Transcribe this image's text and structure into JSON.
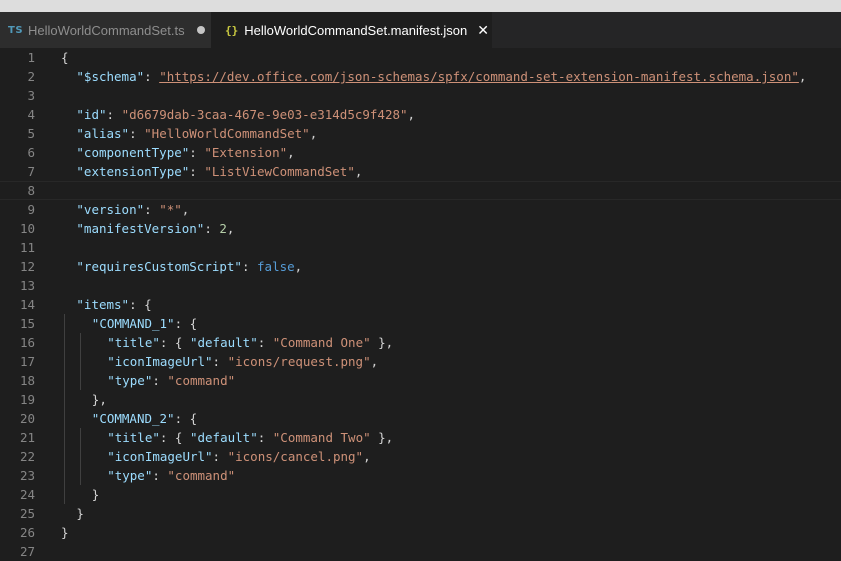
{
  "tabs": [
    {
      "icon_text": "TS",
      "icon": "typescript-file-icon",
      "label": "HelloWorldCommandSet.ts",
      "state": "modified"
    },
    {
      "icon_text": "{}",
      "icon": "json-file-icon",
      "label": "HelloWorldCommandSet.manifest.json",
      "state": "active"
    }
  ],
  "close_glyph": "✕",
  "colors": {
    "editor_bg": "#1e1e1e",
    "key": "#9cdcfe",
    "string": "#ce9178",
    "boolean": "#569cd6",
    "number": "#b5cea8",
    "line_number": "#858585"
  },
  "code_lines": [
    {
      "n": "1",
      "indent": 0,
      "tokens": [
        [
          "p",
          "{"
        ]
      ]
    },
    {
      "n": "2",
      "indent": 1,
      "tokens": [
        [
          "k",
          "\"$schema\""
        ],
        [
          "p",
          ": "
        ],
        [
          "u",
          "\"https://dev.office.com/json-schemas/spfx/command-set-extension-manifest.schema.json\""
        ],
        [
          "p",
          ","
        ]
      ]
    },
    {
      "n": "3",
      "indent": 1,
      "tokens": []
    },
    {
      "n": "4",
      "indent": 1,
      "tokens": [
        [
          "k",
          "\"id\""
        ],
        [
          "p",
          ": "
        ],
        [
          "s",
          "\"d6679dab-3caa-467e-9e03-e314d5c9f428\""
        ],
        [
          "p",
          ","
        ]
      ]
    },
    {
      "n": "5",
      "indent": 1,
      "tokens": [
        [
          "k",
          "\"alias\""
        ],
        [
          "p",
          ": "
        ],
        [
          "s",
          "\"HelloWorldCommandSet\""
        ],
        [
          "p",
          ","
        ]
      ]
    },
    {
      "n": "6",
      "indent": 1,
      "tokens": [
        [
          "k",
          "\"componentType\""
        ],
        [
          "p",
          ": "
        ],
        [
          "s",
          "\"Extension\""
        ],
        [
          "p",
          ","
        ]
      ]
    },
    {
      "n": "7",
      "indent": 1,
      "tokens": [
        [
          "k",
          "\"extensionType\""
        ],
        [
          "p",
          ": "
        ],
        [
          "s",
          "\"ListViewCommandSet\""
        ],
        [
          "p",
          ","
        ]
      ]
    },
    {
      "n": "8",
      "indent": 0,
      "tokens": [],
      "current": true
    },
    {
      "n": "9",
      "indent": 1,
      "tokens": [
        [
          "k",
          "\"version\""
        ],
        [
          "p",
          ": "
        ],
        [
          "s",
          "\"*\""
        ],
        [
          "p",
          ","
        ]
      ]
    },
    {
      "n": "10",
      "indent": 1,
      "tokens": [
        [
          "k",
          "\"manifestVersion\""
        ],
        [
          "p",
          ": "
        ],
        [
          "n",
          "2"
        ],
        [
          "p",
          ","
        ]
      ]
    },
    {
      "n": "11",
      "indent": 1,
      "tokens": []
    },
    {
      "n": "12",
      "indent": 1,
      "tokens": [
        [
          "k",
          "\"requiresCustomScript\""
        ],
        [
          "p",
          ": "
        ],
        [
          "b",
          "false"
        ],
        [
          "p",
          ","
        ]
      ]
    },
    {
      "n": "13",
      "indent": 1,
      "tokens": []
    },
    {
      "n": "14",
      "indent": 1,
      "tokens": [
        [
          "k",
          "\"items\""
        ],
        [
          "p",
          ": {"
        ]
      ]
    },
    {
      "n": "15",
      "indent": 2,
      "tokens": [
        [
          "k",
          "\"COMMAND_1\""
        ],
        [
          "p",
          ": {"
        ]
      ]
    },
    {
      "n": "16",
      "indent": 3,
      "tokens": [
        [
          "k",
          "\"title\""
        ],
        [
          "p",
          ": { "
        ],
        [
          "k",
          "\"default\""
        ],
        [
          "p",
          ": "
        ],
        [
          "s",
          "\"Command One\""
        ],
        [
          "p",
          " },"
        ]
      ]
    },
    {
      "n": "17",
      "indent": 3,
      "tokens": [
        [
          "k",
          "\"iconImageUrl\""
        ],
        [
          "p",
          ": "
        ],
        [
          "s",
          "\"icons/request.png\""
        ],
        [
          "p",
          ","
        ]
      ]
    },
    {
      "n": "18",
      "indent": 3,
      "tokens": [
        [
          "k",
          "\"type\""
        ],
        [
          "p",
          ": "
        ],
        [
          "s",
          "\"command\""
        ]
      ]
    },
    {
      "n": "19",
      "indent": 2,
      "tokens": [
        [
          "p",
          "},"
        ]
      ]
    },
    {
      "n": "20",
      "indent": 2,
      "tokens": [
        [
          "k",
          "\"COMMAND_2\""
        ],
        [
          "p",
          ": {"
        ]
      ]
    },
    {
      "n": "21",
      "indent": 3,
      "tokens": [
        [
          "k",
          "\"title\""
        ],
        [
          "p",
          ": { "
        ],
        [
          "k",
          "\"default\""
        ],
        [
          "p",
          ": "
        ],
        [
          "s",
          "\"Command Two\""
        ],
        [
          "p",
          " },"
        ]
      ]
    },
    {
      "n": "22",
      "indent": 3,
      "tokens": [
        [
          "k",
          "\"iconImageUrl\""
        ],
        [
          "p",
          ": "
        ],
        [
          "s",
          "\"icons/cancel.png\""
        ],
        [
          "p",
          ","
        ]
      ]
    },
    {
      "n": "23",
      "indent": 3,
      "tokens": [
        [
          "k",
          "\"type\""
        ],
        [
          "p",
          ": "
        ],
        [
          "s",
          "\"command\""
        ]
      ]
    },
    {
      "n": "24",
      "indent": 2,
      "tokens": [
        [
          "p",
          "}"
        ]
      ]
    },
    {
      "n": "25",
      "indent": 1,
      "tokens": [
        [
          "p",
          "}"
        ]
      ]
    },
    {
      "n": "26",
      "indent": 0,
      "tokens": [
        [
          "p",
          "}"
        ]
      ]
    },
    {
      "n": "27",
      "indent": 0,
      "tokens": []
    }
  ]
}
